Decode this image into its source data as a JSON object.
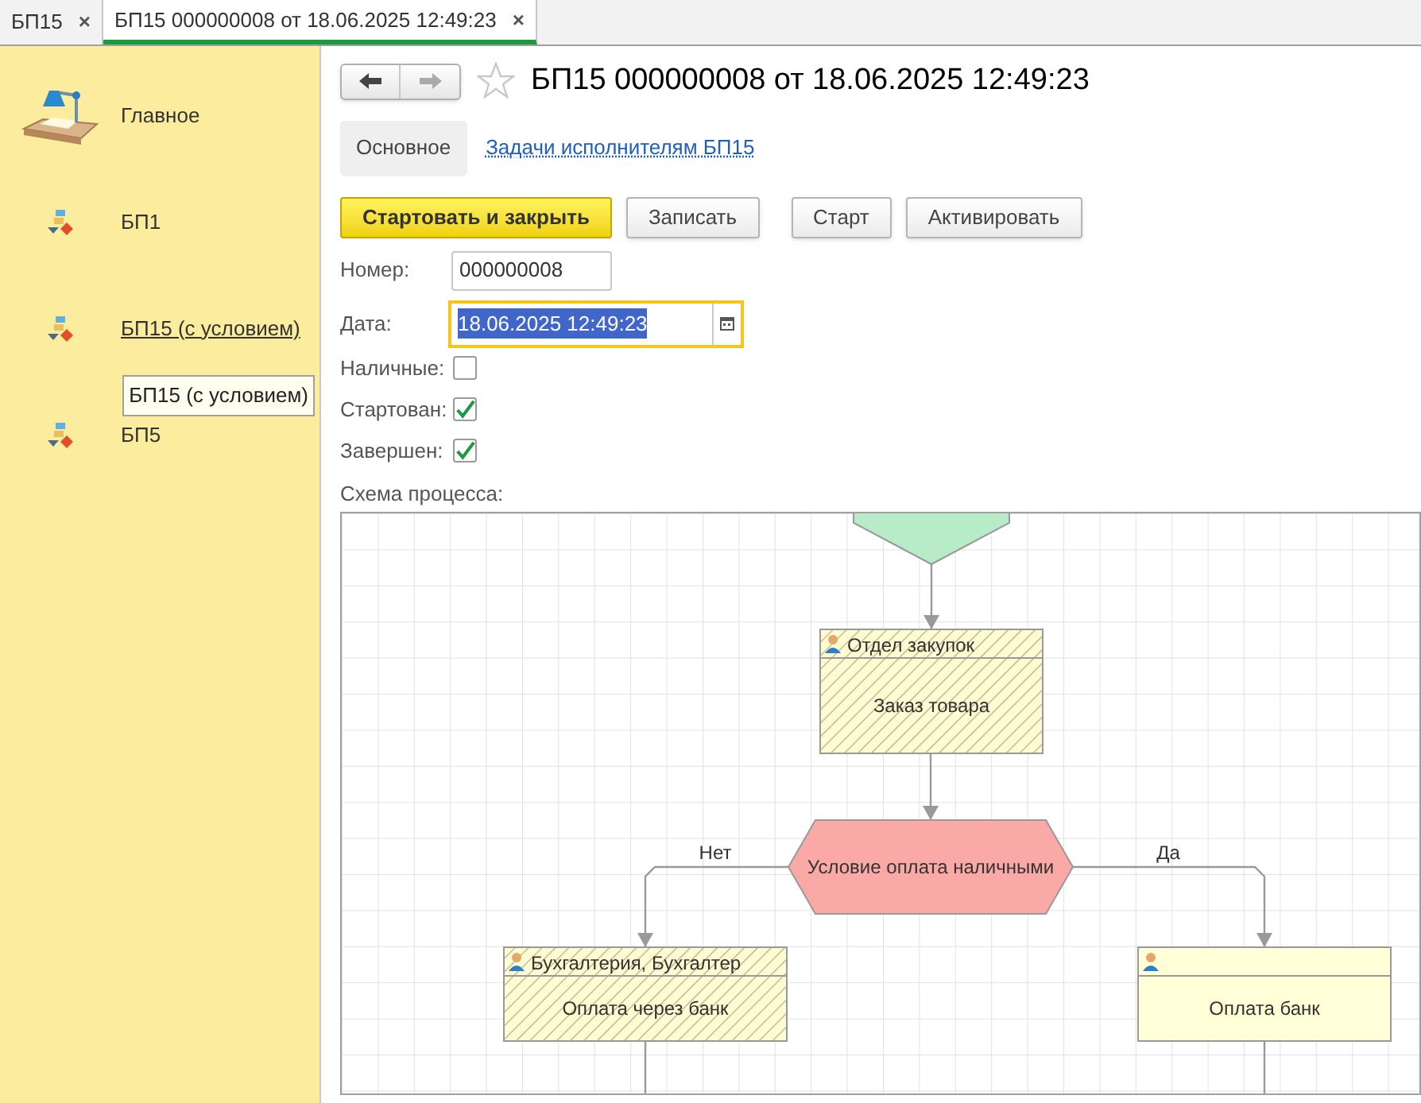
{
  "tabs": [
    {
      "label": "БП15",
      "selected": false,
      "close": "×"
    },
    {
      "label": "БП15 000000008 от 18.06.2025 12:49:23",
      "selected": true,
      "close": "×"
    }
  ],
  "sidebar": {
    "items": [
      {
        "label": "Главное",
        "kind": "home",
        "hovered": false
      },
      {
        "label": "БП1",
        "kind": "process",
        "hovered": false
      },
      {
        "label": "БП15 (с условием)",
        "kind": "process",
        "hovered": true
      },
      {
        "label": "БП5",
        "kind": "process",
        "hovered": false
      }
    ],
    "tooltip": "БП15 (с условием)"
  },
  "form": {
    "title": "БП15 000000008 от 18.06.2025 12:49:23",
    "subtabs": [
      {
        "label": "Основное",
        "selected": true
      },
      {
        "label": "Задачи исполнителям БП15",
        "selected": false
      }
    ],
    "buttons": [
      {
        "label": "Стартовать и закрыть",
        "kind": "primary"
      },
      {
        "label": "Записать",
        "kind": "normal"
      },
      {
        "label": "Старт",
        "kind": "normal"
      },
      {
        "label": "Активировать",
        "kind": "normal"
      }
    ],
    "fields": [
      {
        "label": "Номер:",
        "value": "000000008",
        "kind": "text",
        "focused": false
      },
      {
        "label": "Дата:",
        "value": "18.06.2025 12:49:23",
        "kind": "date",
        "focused": true
      }
    ],
    "checkboxes": [
      {
        "label": "Наличные:",
        "checked": false
      },
      {
        "label": "Стартован:",
        "checked": true
      },
      {
        "label": "Завершен:",
        "checked": true
      }
    ],
    "diagram": {
      "label": "Схема процесса:",
      "nodes": [
        {
          "kind": "start"
        },
        {
          "kind": "task",
          "performer": "Отдел закупок",
          "title": "Заказ товара",
          "completed": true
        },
        {
          "kind": "condition",
          "title": "Условие оплата наличными",
          "branches": [
            {
              "label": "Нет"
            },
            {
              "label": "Да"
            }
          ]
        },
        {
          "kind": "task",
          "performer": "Бухгалтерия, Бухгалтер",
          "title": "Оплата через банк",
          "completed": true
        },
        {
          "kind": "task",
          "title": "Оплата банк",
          "completed": false
        }
      ]
    }
  }
}
